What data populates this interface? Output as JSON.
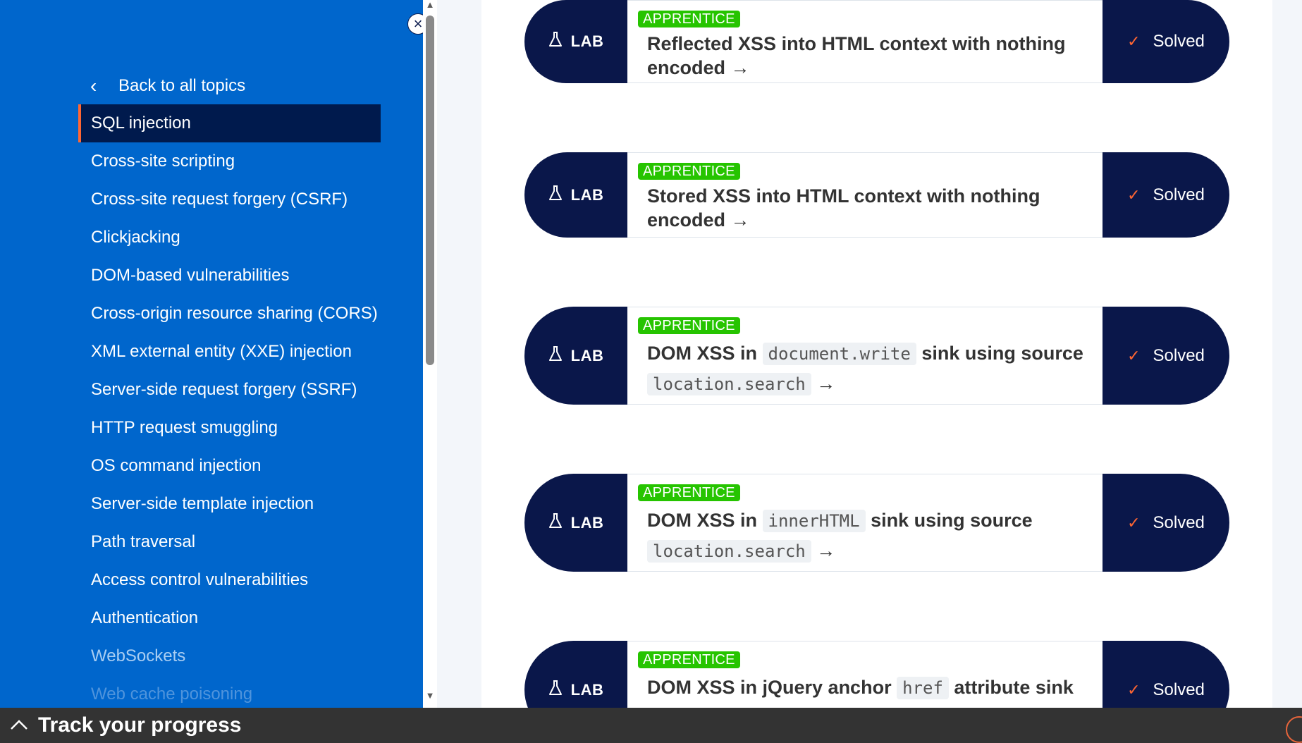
{
  "sidebar": {
    "close_icon": "×",
    "back_label": "Back to all topics",
    "items": [
      {
        "label": "SQL injection"
      },
      {
        "label": "Cross-site scripting"
      },
      {
        "label": "Cross-site request forgery (CSRF)"
      },
      {
        "label": "Clickjacking"
      },
      {
        "label": "DOM-based vulnerabilities"
      },
      {
        "label": "Cross-origin resource sharing (CORS)"
      },
      {
        "label": "XML external entity (XXE) injection"
      },
      {
        "label": "Server-side request forgery (SSRF)"
      },
      {
        "label": "HTTP request smuggling"
      },
      {
        "label": "OS command injection"
      },
      {
        "label": "Server-side template injection"
      },
      {
        "label": "Path traversal"
      },
      {
        "label": "Access control vulnerabilities"
      },
      {
        "label": "Authentication"
      },
      {
        "label": "WebSockets"
      },
      {
        "label": "Web cache poisoning"
      }
    ]
  },
  "labs": [
    {
      "tag": "LAB",
      "level": "APPRENTICE",
      "title_parts": [
        "Reflected XSS into HTML context with nothing encoded"
      ],
      "status": "Solved"
    },
    {
      "tag": "LAB",
      "level": "APPRENTICE",
      "title_parts": [
        "Stored XSS into HTML context with nothing encoded"
      ],
      "status": "Solved"
    },
    {
      "tag": "LAB",
      "level": "APPRENTICE",
      "title_parts": [
        "DOM XSS in",
        "document.write",
        "sink using source",
        "location.search"
      ],
      "status": "Solved"
    },
    {
      "tag": "LAB",
      "level": "APPRENTICE",
      "title_parts": [
        "DOM XSS in",
        "innerHTML",
        "sink using source",
        "location.search"
      ],
      "status": "Solved"
    },
    {
      "tag": "LAB",
      "level": "APPRENTICE",
      "title_parts": [
        "DOM XSS in jQuery anchor",
        "href",
        "attribute sink"
      ],
      "status": "Solved"
    }
  ],
  "footer": {
    "track_label": "Track your progress"
  },
  "colors": {
    "sidebar_bg": "#0066cc",
    "nav_active_bg": "#001a4d",
    "accent": "#ff6633",
    "card_dark": "#0a174a",
    "badge_green": "#26c400",
    "footer_bg": "#333333"
  }
}
